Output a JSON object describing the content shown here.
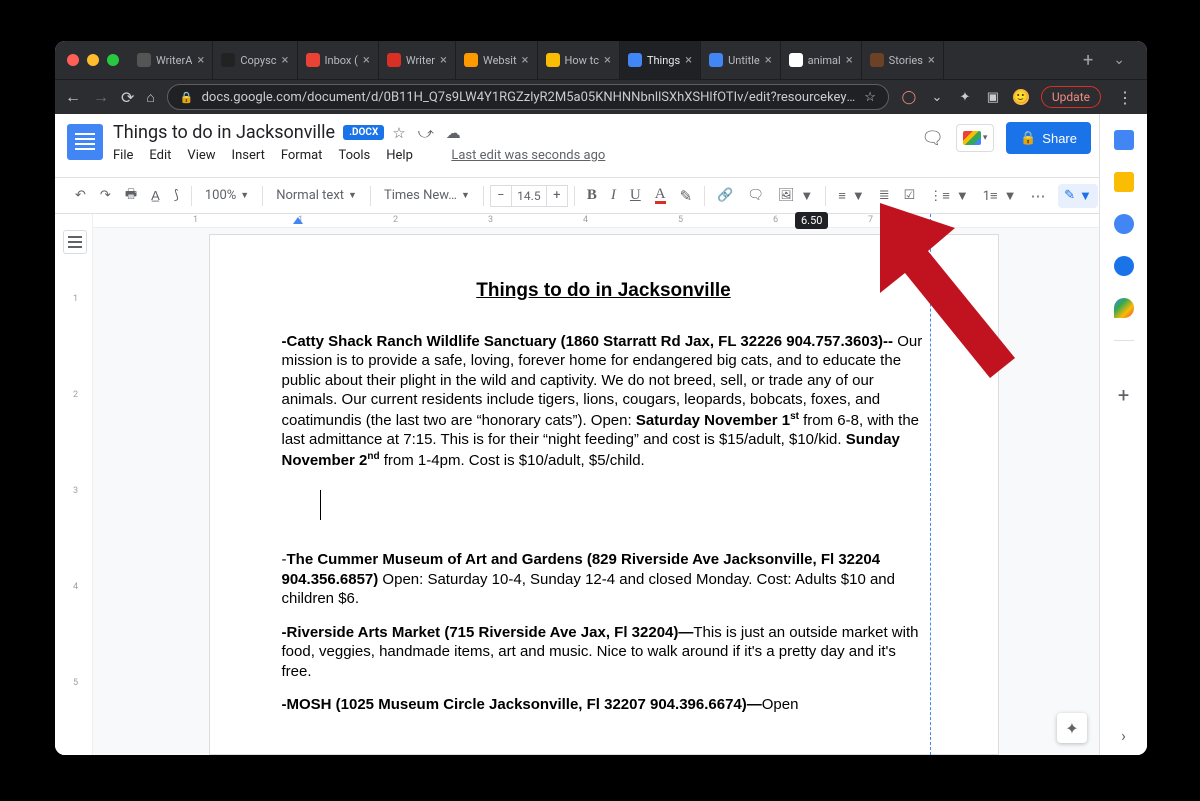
{
  "browser": {
    "tabs": [
      {
        "fav": "#555",
        "label": "WriterA",
        "active": false
      },
      {
        "fav": "#222",
        "label": "Copysc",
        "active": false
      },
      {
        "fav": "#ea4335",
        "label": "Inbox (",
        "active": false
      },
      {
        "fav": "#d93025",
        "label": "Writer",
        "active": false
      },
      {
        "fav": "#ff9900",
        "label": "Websit",
        "active": false
      },
      {
        "fav": "#fbbc04",
        "label": "How tc",
        "active": false
      },
      {
        "fav": "#4285f4",
        "label": "Things",
        "active": true
      },
      {
        "fav": "#4285f4",
        "label": "Untitle",
        "active": false
      },
      {
        "fav": "#fff",
        "label": "animal",
        "active": false
      },
      {
        "fav": "#6b4226",
        "label": "Stories",
        "active": false
      }
    ],
    "url": "docs.google.com/document/d/0B11H_Q7s9LW4Y1RGZzlyR2M5a05KNHNNbnllSXhXSHlfOTIv/edit?resourcekey=0-…",
    "update_label": "Update"
  },
  "header": {
    "title": "Things to do in Jacksonville",
    "badge": ".DOCX",
    "menus": [
      "File",
      "Edit",
      "View",
      "Insert",
      "Format",
      "Tools",
      "Help"
    ],
    "last_edit": "Last edit was seconds ago",
    "share": "Share"
  },
  "toolbar": {
    "zoom": "100%",
    "style": "Normal text",
    "font": "Times New…",
    "size": "14.5"
  },
  "ruler": {
    "h": [
      "1",
      "1",
      "2",
      "3",
      "4",
      "5",
      "6",
      "7"
    ],
    "tooltip": "6.50",
    "v": [
      "1",
      "2",
      "3",
      "4",
      "5"
    ]
  },
  "doc": {
    "title": "Things to do in Jacksonville",
    "p1_a": "-Catty Shack Ranch Wildlife Sanctuary (1860 Starratt Rd Jax, FL 32226 904.757.3603)--",
    "p1_b": " Our mission is to provide a safe, loving, forever home for endangered big cats, and to educate the public about their plight in the wild and captivity. We do not breed, sell, or trade any of our animals. Our current residents include tigers, lions, cougars, leopards, bobcats, foxes, and coatimundis (the last two are “honorary cats”).   Open: ",
    "p1_c": "Saturday November 1",
    "p1_d": " from 6-8, with the last admittance at 7:15. This is for their “night feeding” and cost is $15/adult, $10/kid. ",
    "p1_e": "Sunday November 2",
    "p1_f": " from 1-4pm. Cost is $10/adult, $5/child.",
    "p2_a": "The Cummer Museum of Art and Gardens (829 Riverside Ave Jacksonville, Fl 32204 904.356.6857)",
    "p2_b": " Open: Saturday 10-4, Sunday 12-4 and closed Monday. Cost: Adults $10 and children $6.",
    "p3_a": "-Riverside Arts Market (715 Riverside Ave Jax, Fl 32204)—",
    "p3_b": "This is just an outside market with food,  veggies, handmade items, art and music.  Nice to walk around if it's a pretty day and it's free.",
    "p4_a": "-MOSH (1025 Museum Circle Jacksonville, Fl 32207 904.396.6674)—",
    "p4_b": "Open"
  }
}
